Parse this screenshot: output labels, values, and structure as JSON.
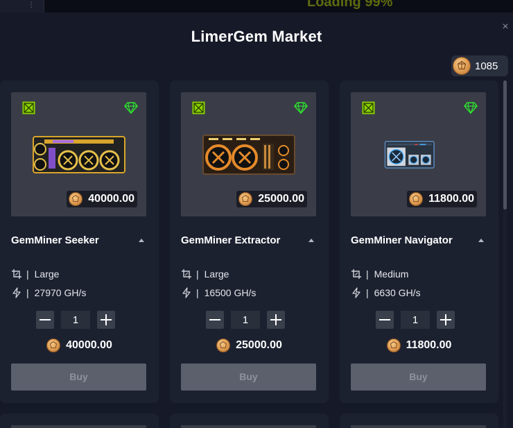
{
  "background": {
    "left_text": "⋮",
    "loading_text": "Loading 99%"
  },
  "modal": {
    "title": "LimerGem Market",
    "close_label": "×",
    "balance": "1085"
  },
  "colors": {
    "accent_green": "#8bd400",
    "gem_green": "#2ee32e",
    "coin_gold": "#e3a35a"
  },
  "products": [
    {
      "name": "GemMiner Seeker",
      "price": "40000.00",
      "size": "Large",
      "hashrate": "27970 GH/s",
      "quantity": "1",
      "total": "40000.00",
      "buy_label": "Buy",
      "style": "gold"
    },
    {
      "name": "GemMiner Extractor",
      "price": "25000.00",
      "size": "Large",
      "hashrate": "16500 GH/s",
      "quantity": "1",
      "total": "25000.00",
      "buy_label": "Buy",
      "style": "orange"
    },
    {
      "name": "GemMiner Navigator",
      "price": "11800.00",
      "size": "Medium",
      "hashrate": "6630 GH/s",
      "quantity": "1",
      "total": "11800.00",
      "buy_label": "Buy",
      "style": "blue"
    }
  ],
  "icons": {
    "tag": "nft-tag-icon",
    "gem": "gem-icon",
    "size": "crop-icon",
    "hashrate": "lightning-icon",
    "coin": "coin-icon"
  }
}
